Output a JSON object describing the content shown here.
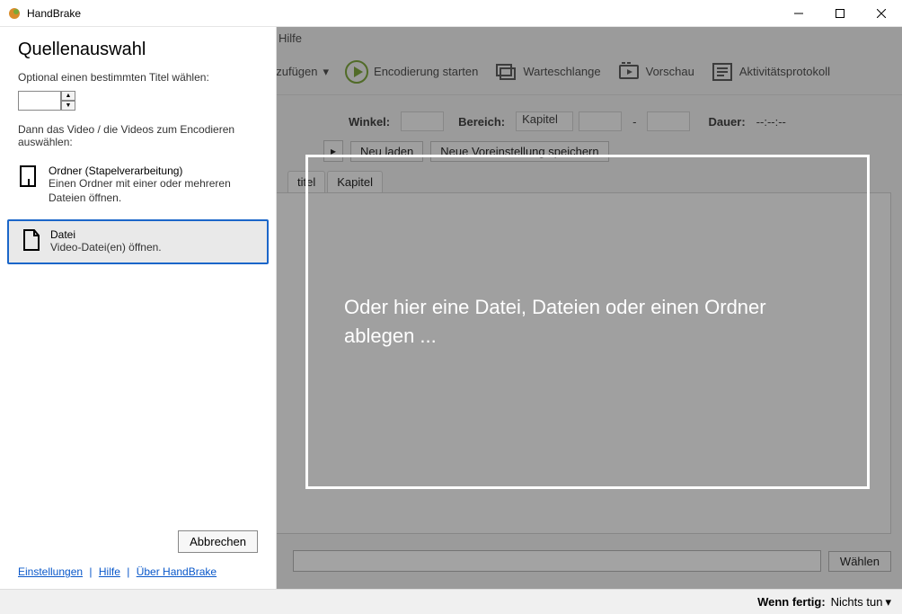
{
  "window": {
    "title": "HandBrake"
  },
  "menu": {
    "help": "Hilfe"
  },
  "toolbar": {
    "add_suffix": "nzufügen",
    "start": "Encodierung starten",
    "queue": "Warteschlange",
    "preview": "Vorschau",
    "activity": "Aktivitätsprotokoll"
  },
  "source_row": {
    "angle_label": "Winkel:",
    "range_label": "Bereich:",
    "range_value": "Kapitel",
    "dash": "-",
    "duration_label": "Dauer:",
    "duration_value": "--:--:--"
  },
  "preset_row": {
    "reload": "Neu laden",
    "save": "Neue Voreinstellung speichern"
  },
  "tabs": {
    "title_partial": "titel",
    "chapter": "Kapitel"
  },
  "dest": {
    "choose": "Wählen"
  },
  "statusbar": {
    "when_done_label": "Wenn fertig:",
    "when_done_value": "Nichts tun"
  },
  "dropzone": {
    "text": "Oder hier eine Datei, Dateien oder einen Ordner ablegen ..."
  },
  "panel": {
    "heading": "Quellenauswahl",
    "hint1": "Optional einen bestimmten Titel wählen:",
    "hint2": "Dann das Video / die Videos zum Encodieren auswählen:",
    "option_folder_title": "Ordner (Stapelverarbeitung)",
    "option_folder_desc": "Einen Ordner mit einer oder mehreren Dateien öffnen.",
    "option_file_title": "Datei",
    "option_file_desc": "Video-Datei(en) öffnen.",
    "cancel": "Abbrechen",
    "link_settings": "Einstellungen",
    "link_help": "Hilfe",
    "link_about": "Über HandBrake"
  }
}
